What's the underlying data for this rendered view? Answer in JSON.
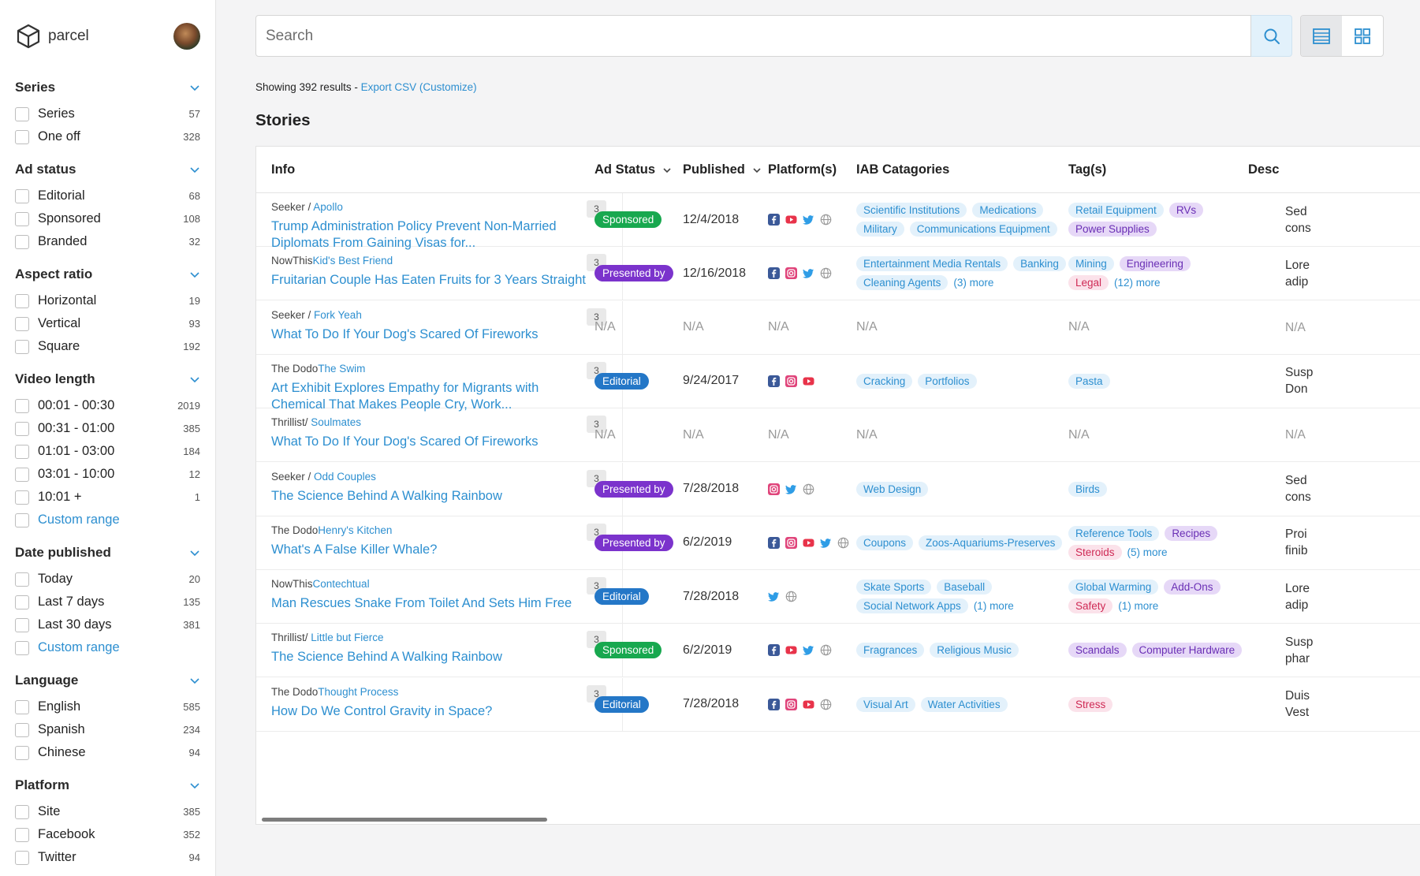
{
  "app": {
    "name": "parcel"
  },
  "sidebar": {
    "groups": [
      {
        "title": "Series",
        "options": [
          {
            "label": "Series",
            "count": "57"
          },
          {
            "label": "One off",
            "count": "328"
          }
        ]
      },
      {
        "title": "Ad status",
        "options": [
          {
            "label": "Editorial",
            "count": "68"
          },
          {
            "label": "Sponsored",
            "count": "108"
          },
          {
            "label": "Branded",
            "count": "32"
          }
        ]
      },
      {
        "title": "Aspect ratio",
        "options": [
          {
            "label": "Horizontal",
            "count": "19"
          },
          {
            "label": "Vertical",
            "count": "93"
          },
          {
            "label": "Square",
            "count": "192"
          }
        ]
      },
      {
        "title": "Video length",
        "options": [
          {
            "label": "00:01 - 00:30",
            "count": "2019"
          },
          {
            "label": "00:31 - 01:00",
            "count": "385"
          },
          {
            "label": "01:01 - 03:00",
            "count": "184"
          },
          {
            "label": "03:01 - 10:00",
            "count": "12"
          },
          {
            "label": "10:01 +",
            "count": "1"
          },
          {
            "label": "Custom range",
            "count": "",
            "link": true
          }
        ]
      },
      {
        "title": "Date published",
        "options": [
          {
            "label": "Today",
            "count": "20"
          },
          {
            "label": "Last 7 days",
            "count": "135"
          },
          {
            "label": "Last 30 days",
            "count": "381"
          },
          {
            "label": "Custom range",
            "count": "",
            "link": true
          }
        ]
      },
      {
        "title": "Language",
        "options": [
          {
            "label": "English",
            "count": "585"
          },
          {
            "label": "Spanish",
            "count": "234"
          },
          {
            "label": "Chinese",
            "count": "94"
          }
        ]
      },
      {
        "title": "Platform",
        "options": [
          {
            "label": "Site",
            "count": "385"
          },
          {
            "label": "Facebook",
            "count": "352"
          },
          {
            "label": "Twitter",
            "count": "94"
          }
        ]
      }
    ]
  },
  "search": {
    "placeholder": "Search",
    "value": ""
  },
  "results": {
    "showing": "Showing 392 results - ",
    "export": "Export CSV (Customize)"
  },
  "section_title": "Stories",
  "columns": {
    "info": "Info",
    "ad_status": "Ad Status",
    "published": "Published",
    "platforms": "Platform(s)",
    "iab": "IAB Catagories",
    "tags": "Tag(s)",
    "desc": "Desc"
  },
  "colors": {
    "accent": "#2d8fd0",
    "sponsored": "#18a84f",
    "presented": "#7b33cc",
    "editorial": "#2477c7"
  },
  "rows": [
    {
      "publisher": "Seeker / ",
      "program": "Apollo",
      "title": "Trump Administration Policy Prevent Non-Married Diplomats From Gaining Visas for...",
      "count": "3",
      "status": "Sponsored",
      "status_type": "sponsored",
      "date": "12/4/2018",
      "platforms": [
        "facebook-icon",
        "youtube-icon",
        "twitter-icon",
        "globe-icon"
      ],
      "iab": [
        [
          "Scientific Institutions",
          "Medications"
        ],
        [
          "Military",
          "Communications Equipment"
        ]
      ],
      "iab_more": "",
      "tags": [
        [
          [
            "Retail Equipment",
            "blue"
          ],
          [
            "RVs",
            "purple"
          ]
        ],
        [
          [
            "Power Supplies",
            "purple"
          ]
        ]
      ],
      "tags_more": "",
      "desc": [
        "Sed",
        "cons"
      ]
    },
    {
      "publisher": "NowThis",
      "program": "Kid's Best Friend",
      "title": "Fruitarian Couple Has Eaten Fruits for 3 Years Straight",
      "count": "3",
      "status": "Presented by",
      "status_type": "presented",
      "date": "12/16/2018",
      "platforms": [
        "facebook-icon",
        "instagram-icon",
        "twitter-icon",
        "globe-icon"
      ],
      "iab": [
        [
          "Entertainment Media Rentals",
          "Banking"
        ],
        [
          "Cleaning Agents"
        ]
      ],
      "iab_more": "(3) more",
      "tags": [
        [
          [
            "Mining",
            "blue"
          ],
          [
            "Engineering",
            "purple"
          ]
        ],
        [
          [
            "Legal",
            "pink"
          ]
        ]
      ],
      "tags_more": "(12) more",
      "desc": [
        "Lore",
        "adip"
      ]
    },
    {
      "publisher": "Seeker / ",
      "program": "Fork Yeah",
      "title": "What To Do If Your Dog's Scared Of Fireworks",
      "count": "3",
      "status": "N/A",
      "status_type": "na",
      "date": "N/A",
      "platforms_na": "N/A",
      "iab_na": "N/A",
      "tags_na": "N/A",
      "desc": [
        "N/A"
      ]
    },
    {
      "publisher": "The Dodo",
      "program": "The Swim",
      "title": "Art Exhibit Explores Empathy for Migrants with Chemical That Makes People Cry, Work...",
      "count": "3",
      "status": "Editorial",
      "status_type": "editorial",
      "date": "9/24/2017",
      "platforms": [
        "facebook-icon",
        "instagram-icon",
        "youtube-icon"
      ],
      "iab": [
        [
          "Cracking",
          "Portfolios"
        ]
      ],
      "iab_more": "",
      "tags": [
        [
          [
            "Pasta",
            "blue"
          ]
        ]
      ],
      "tags_more": "",
      "desc": [
        "Susp",
        "Don"
      ]
    },
    {
      "publisher": "Thrillist/ ",
      "program": "Soulmates",
      "title": "What To Do If Your Dog's Scared Of Fireworks",
      "count": "3",
      "status": "N/A",
      "status_type": "na",
      "date": "N/A",
      "platforms_na": "N/A",
      "iab_na": "N/A",
      "tags_na": "N/A",
      "desc": [
        "N/A"
      ]
    },
    {
      "publisher": "Seeker / ",
      "program": "Odd Couples",
      "title": "The Science Behind A Walking Rainbow",
      "count": "3",
      "status": "Presented by",
      "status_type": "presented",
      "date": "7/28/2018",
      "platforms": [
        "instagram-icon",
        "twitter-icon",
        "globe-icon"
      ],
      "iab": [
        [
          "Web Design"
        ]
      ],
      "iab_more": "",
      "tags": [
        [
          [
            "Birds",
            "blue"
          ]
        ]
      ],
      "tags_more": "",
      "desc": [
        "Sed",
        "cons"
      ]
    },
    {
      "publisher": "The Dodo",
      "program": "Henry's Kitchen",
      "title": "What's A False Killer Whale?",
      "count": "3",
      "status": "Presented by",
      "status_type": "presented",
      "date": "6/2/2019",
      "platforms": [
        "facebook-icon",
        "instagram-icon",
        "youtube-icon",
        "twitter-icon",
        "globe-icon"
      ],
      "iab": [
        [
          "Coupons",
          "Zoos-Aquariums-Preserves"
        ]
      ],
      "iab_more": "",
      "tags": [
        [
          [
            "Reference Tools",
            "blue"
          ],
          [
            "Recipes",
            "purple"
          ]
        ],
        [
          [
            "Steroids",
            "pink"
          ]
        ]
      ],
      "tags_more": "(5) more",
      "desc": [
        "Proi",
        "finib"
      ]
    },
    {
      "publisher": "NowThis",
      "program": "Contechtual",
      "title": "Man Rescues Snake From Toilet And Sets Him Free",
      "count": "3",
      "status": "Editorial",
      "status_type": "editorial",
      "date": "7/28/2018",
      "platforms": [
        "twitter-icon",
        "globe-icon"
      ],
      "iab": [
        [
          "Skate Sports",
          "Baseball"
        ],
        [
          "Social Network Apps"
        ]
      ],
      "iab_more": "(1) more",
      "tags": [
        [
          [
            "Global Warming",
            "blue"
          ],
          [
            "Add-Ons",
            "purple"
          ]
        ],
        [
          [
            "Safety",
            "pink"
          ]
        ]
      ],
      "tags_more": "(1) more",
      "desc": [
        "Lore",
        "adip"
      ]
    },
    {
      "publisher": "Thrillist/ ",
      "program": "Little but Fierce",
      "title": "The Science Behind A Walking Rainbow",
      "count": "3",
      "status": "Sponsored",
      "status_type": "sponsored",
      "date": "6/2/2019",
      "platforms": [
        "facebook-icon",
        "youtube-icon",
        "twitter-icon",
        "globe-icon"
      ],
      "iab": [
        [
          "Fragrances",
          "Religious Music"
        ]
      ],
      "iab_more": "",
      "tags": [
        [
          [
            "Scandals",
            "purple"
          ],
          [
            "Computer Hardware",
            "purple"
          ]
        ]
      ],
      "tags_more": "",
      "desc": [
        "Susp",
        "phar"
      ]
    },
    {
      "publisher": "The Dodo",
      "program": "Thought Process",
      "title": "How Do We Control Gravity in Space?",
      "count": "3",
      "status": "Editorial",
      "status_type": "editorial",
      "date": "7/28/2018",
      "platforms": [
        "facebook-icon",
        "instagram-icon",
        "youtube-icon",
        "globe-icon"
      ],
      "iab": [
        [
          "Visual Art",
          "Water Activities"
        ]
      ],
      "iab_more": "",
      "tags": [
        [
          [
            "Stress",
            "pink"
          ]
        ]
      ],
      "tags_more": "",
      "desc": [
        "Duis",
        "Vest"
      ]
    }
  ]
}
